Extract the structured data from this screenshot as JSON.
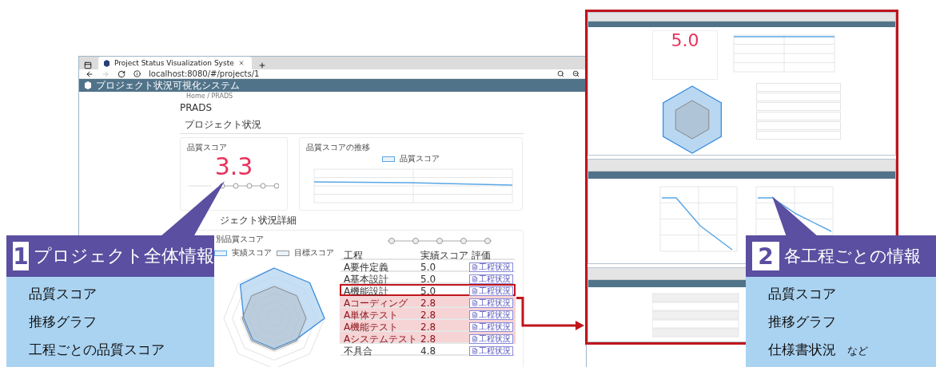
{
  "main_window": {
    "tab_title": "Project Status Visualization Syste",
    "address": "localhost:8080/#/projects/1",
    "app_title": "プロジェクト状況可視化システム",
    "breadcrumb": "Home / PRADS",
    "page_title": "PRADS",
    "section_title": "プロジェクト状況",
    "score_card": {
      "title": "品質スコア",
      "score": "3.3"
    },
    "trend_card": {
      "title": "品質スコアの推移",
      "legend": "品質スコア"
    },
    "detail_title": "ジェクト状況詳細",
    "detail_card": {
      "title": "別品質スコア",
      "legend": [
        "実績スコア",
        "目標スコア"
      ],
      "columns": [
        "工程",
        "実績スコア",
        "評価"
      ],
      "rows": [
        {
          "process": "A要件定義",
          "score": "5.0",
          "button": "工程状況",
          "low": false,
          "highlighted": false
        },
        {
          "process": "A基本設計",
          "score": "5.0",
          "button": "工程状況",
          "low": false,
          "highlighted": false
        },
        {
          "process": "A機能設計",
          "score": "5.0",
          "button": "工程状況",
          "low": false,
          "highlighted": true
        },
        {
          "process": "Aコーディング",
          "score": "2.8",
          "button": "工程状況",
          "low": true,
          "highlighted": false
        },
        {
          "process": "A単体テスト",
          "score": "2.8",
          "button": "工程状況",
          "low": true,
          "highlighted": false
        },
        {
          "process": "A機能テスト",
          "score": "2.8",
          "button": "工程状況",
          "low": true,
          "highlighted": false
        },
        {
          "process": "Aシステムテスト",
          "score": "2.8",
          "button": "工程状況",
          "low": true,
          "highlighted": false
        },
        {
          "process": "不具合",
          "score": "4.8",
          "button": "工程状況",
          "low": false,
          "highlighted": false
        }
      ]
    }
  },
  "detail_windows": {
    "score": "5.0"
  },
  "callouts": [
    {
      "number": "1",
      "title": "プロジェクト全体情報",
      "items": [
        "品質スコア",
        "推移グラフ",
        "工程ごとの品質スコア"
      ]
    },
    {
      "number": "2",
      "title": "各工程ごとの情報",
      "items": [
        "品質スコア",
        "推移グラフ",
        "仕様書状況"
      ],
      "note": "など"
    }
  ]
}
